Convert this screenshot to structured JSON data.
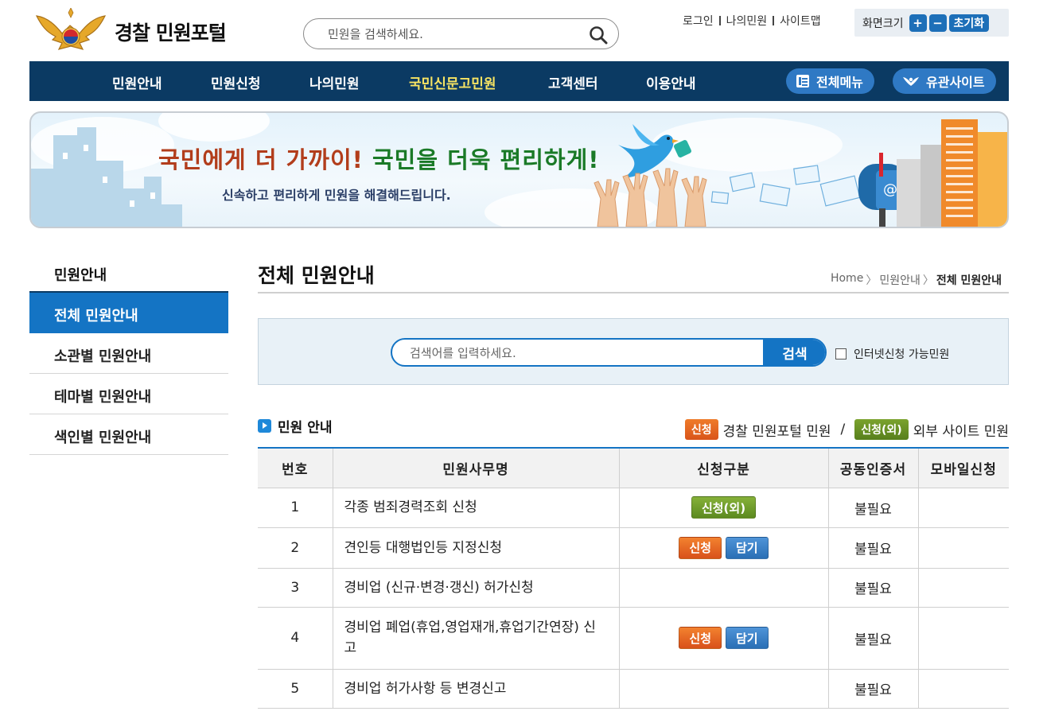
{
  "site": {
    "title": "경찰 민원포털"
  },
  "top_search": {
    "placeholder": "민원을 검색하세요."
  },
  "util_links": [
    "로그인",
    "나의민원",
    "사이트맵"
  ],
  "zoom": {
    "label": "화면크기",
    "plus": "+",
    "minus": "−",
    "reset": "초기화"
  },
  "nav": {
    "items": [
      "민원안내",
      "민원신청",
      "나의민원",
      "국민신문고민원",
      "고객센터",
      "이용안내"
    ],
    "active_index": 3,
    "all_menu": "전체메뉴",
    "related_sites": "유관사이트"
  },
  "banner": {
    "headline_part1": "국민에게 더 가까이!",
    "headline_part2": "국민을 더욱 편리하게!",
    "sub": "신속하고 편리하게 민원을 해결해드립니다."
  },
  "sidebar": {
    "title": "민원안내",
    "items": [
      "전체 민원안내",
      "소관별 민원안내",
      "테마별 민원안내",
      "색인별 민원안내"
    ],
    "active_index": 0
  },
  "page": {
    "title": "전체 민원안내",
    "breadcrumb": [
      "Home",
      "민원안내",
      "전체 민원안내"
    ]
  },
  "content_search": {
    "placeholder": "검색어를 입력하세요.",
    "button": "검색",
    "checkbox_label": "인터넷신청 가능민원",
    "checked": false
  },
  "section": {
    "title": "민원 안내",
    "legend": [
      {
        "tag": "신청",
        "text": "경찰 민원포털 민원",
        "color": "#e2611f"
      },
      {
        "tag": "신청(외)",
        "text": "외부 사이트 민원",
        "color": "#6a9526"
      }
    ]
  },
  "table": {
    "headers": [
      "번호",
      "민원사무명",
      "신청구분",
      "공동인증서",
      "모바일신청"
    ],
    "rows": [
      {
        "no": "1",
        "name": "각종 범죄경력조회 신청",
        "buttons": [
          "신청(외)"
        ],
        "cert": "불필요",
        "mobile": ""
      },
      {
        "no": "2",
        "name": "견인등 대행법인등 지정신청",
        "buttons": [
          "신청",
          "담기"
        ],
        "cert": "불필요",
        "mobile": ""
      },
      {
        "no": "3",
        "name": "경비업 (신규·변경·갱신) 허가신청",
        "buttons": [],
        "cert": "불필요",
        "mobile": ""
      },
      {
        "no": "4",
        "name": "경비업 폐업(휴업,영업재개,휴업기간연장) 신고",
        "buttons": [
          "신청",
          "담기"
        ],
        "cert": "불필요",
        "mobile": ""
      },
      {
        "no": "5",
        "name": "경비업 허가사항 등 변경신고",
        "buttons": [],
        "cert": "불필요",
        "mobile": ""
      }
    ]
  },
  "colors": {
    "nav_bg": "#0b3a63",
    "accent_blue": "#1474c4",
    "nav_active": "#f7e463",
    "apply_orange": "#e2611f",
    "external_green": "#6a9526",
    "cart_blue": "#3b82c8"
  }
}
